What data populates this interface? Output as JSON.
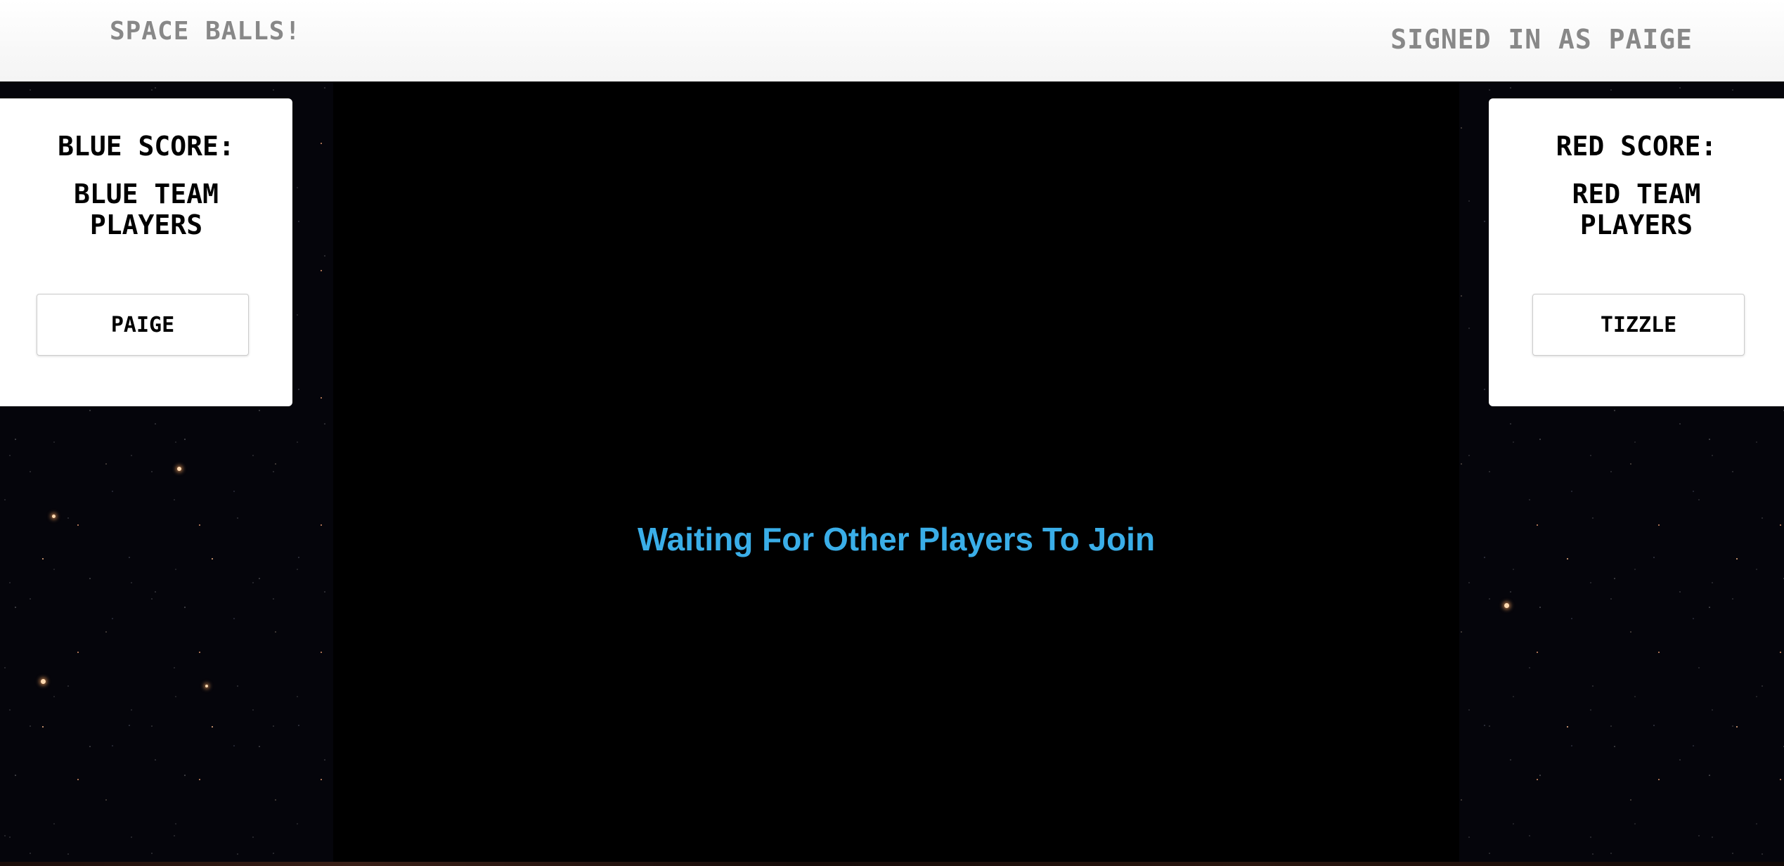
{
  "navbar": {
    "brand": "Space Balls!",
    "signed_in": "Signed in as Paige"
  },
  "blue_panel": {
    "score_label": "Blue Score:",
    "team_heading": "Blue Team Players",
    "players": [
      "Paige"
    ]
  },
  "red_panel": {
    "score_label": "Red Score:",
    "team_heading": "Red Team Players",
    "players": [
      "Tizzle"
    ]
  },
  "game": {
    "status_message": "Waiting For Other Players To Join"
  },
  "colors": {
    "status_text": "#3aaee8",
    "navbar_text": "#888888",
    "game_background": "#000000"
  }
}
